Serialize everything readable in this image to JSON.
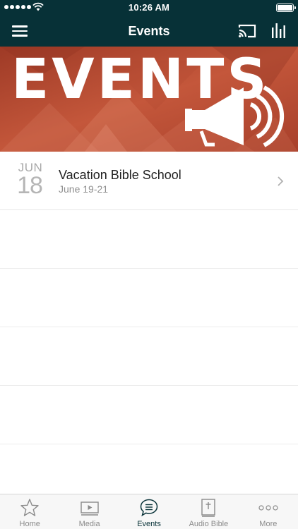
{
  "status_bar": {
    "time": "10:26 AM",
    "signal_dots": 5
  },
  "nav": {
    "title": "Events",
    "menu_icon": "hamburger-menu-icon",
    "cast_icon": "cast-icon",
    "bars_icon": "bar-chart-icon"
  },
  "banner": {
    "text": "EVENTS",
    "icon": "megaphone-icon",
    "colors": {
      "primary": "#b84630",
      "dark": "#8f3322"
    }
  },
  "events": [
    {
      "month": "JUN",
      "day": "18",
      "title": "Vacation Bible School",
      "subtitle": "June 19-21"
    }
  ],
  "tabs": [
    {
      "label": "Home",
      "icon": "star-icon",
      "active": false
    },
    {
      "label": "Media",
      "icon": "play-icon",
      "active": false
    },
    {
      "label": "Events",
      "icon": "chat-bubble-icon",
      "active": true
    },
    {
      "label": "Audio Bible",
      "icon": "bible-icon",
      "active": false
    },
    {
      "label": "More",
      "icon": "more-dots-icon",
      "active": false
    }
  ],
  "colors": {
    "header": "#073137",
    "tab_active": "#073137",
    "tab_inactive": "#8a8a8a"
  }
}
